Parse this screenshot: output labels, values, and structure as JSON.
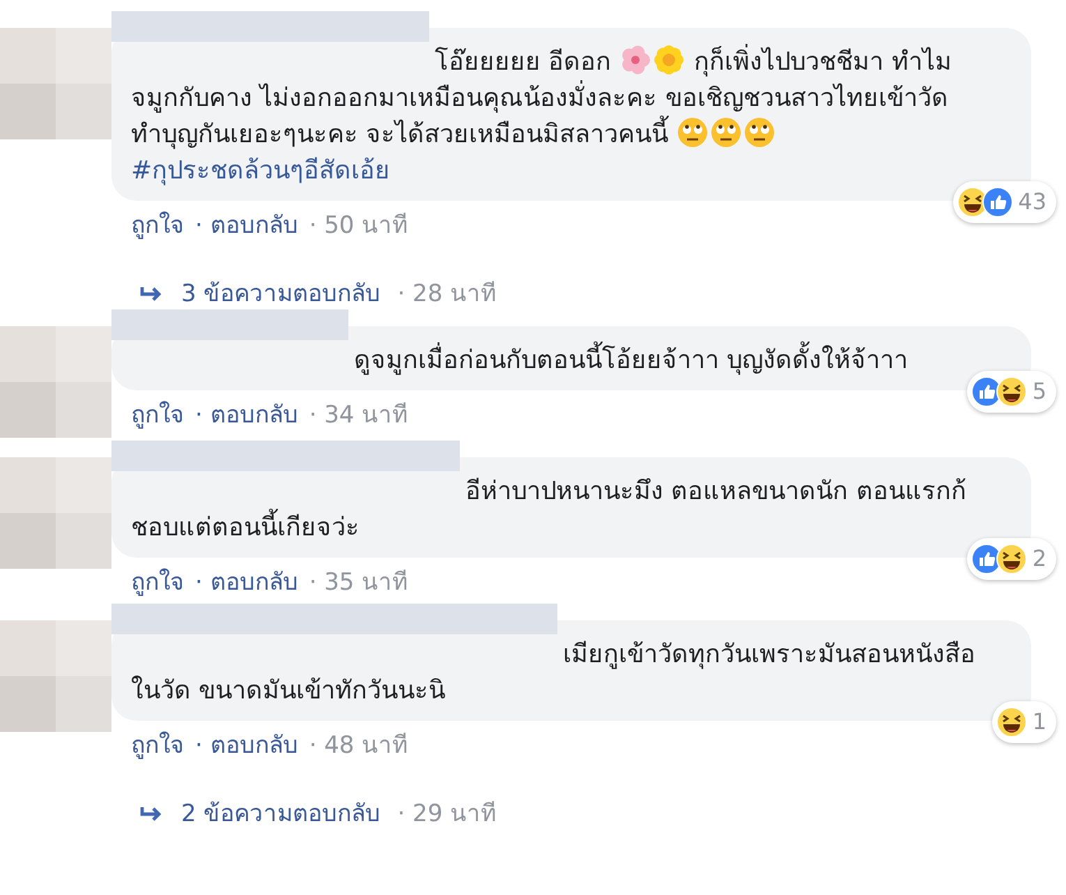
{
  "thread": [
    {
      "kind": "comment",
      "body": [
        {
          "kind": "text",
          "text": "โอ๊ยยยยย อีดอก "
        },
        {
          "kind": "blossom"
        },
        {
          "kind": "sunflower"
        },
        {
          "kind": "text",
          "text": " กุก็เพิ่งไปบวชชีมา ทำไมจมูกกับคาง ไม่งอกออกมาเหมือนคุณน้องมั่งละคะ ขอเชิญชวนสาวไทยเข้าวัดทำบุญกันเยอะๆนะคะ จะได้สวยเหมือนมิสลาวคนนี้ "
        },
        {
          "kind": "eyeroll"
        },
        {
          "kind": "eyeroll"
        },
        {
          "kind": "eyeroll"
        },
        {
          "kind": "break"
        },
        {
          "kind": "hashtag",
          "text": "#กุประชดล้วนๆอีสัดเอ้ย"
        }
      ],
      "reactions": [
        {
          "kind": "haha"
        },
        {
          "kind": "like"
        }
      ],
      "count": "43",
      "like": "ถูกใจ",
      "reply": "· ตอบกลับ",
      "time": "· 50 นาที"
    },
    {
      "kind": "replies",
      "label": "3 ข้อความตอบกลับ",
      "time": "· 28 นาที"
    },
    {
      "kind": "comment",
      "body": [
        {
          "kind": "text",
          "text": "ดูจมูกเมื่อก่อนกับตอนนี้โอ้ยยจ้าาา บุญงัดดั้งให้จ้าาา"
        }
      ],
      "reactions": [
        {
          "kind": "like"
        },
        {
          "kind": "haha"
        }
      ],
      "count": "5",
      "like": "ถูกใจ",
      "reply": "· ตอบกลับ",
      "time": "· 34 นาที"
    },
    {
      "kind": "comment",
      "body": [
        {
          "kind": "text",
          "text": "อีห่าบาปหนานะมึง ตอแหลขนาดนัก ตอนแรกก้ชอบแต่ตอนนี้เกียจว่ะ"
        }
      ],
      "reactions": [
        {
          "kind": "like"
        },
        {
          "kind": "haha"
        }
      ],
      "count": "2",
      "like": "ถูกใจ",
      "reply": "· ตอบกลับ",
      "time": "· 35 นาที"
    },
    {
      "kind": "comment",
      "body": [
        {
          "kind": "text",
          "text": "เมียกูเข้าวัดทุกวันเพราะมันสอนหนังสือในวัด ขนาดมันเข้าทักวันนะนิ"
        }
      ],
      "reactions": [
        {
          "kind": "haha"
        }
      ],
      "count": "1",
      "like": "ถูกใจ",
      "reply": "· ตอบกลับ",
      "time": "· 48 นาที"
    },
    {
      "kind": "replies",
      "label": "2 ข้อความตอบกลับ",
      "time": "· 29 นาที"
    }
  ]
}
